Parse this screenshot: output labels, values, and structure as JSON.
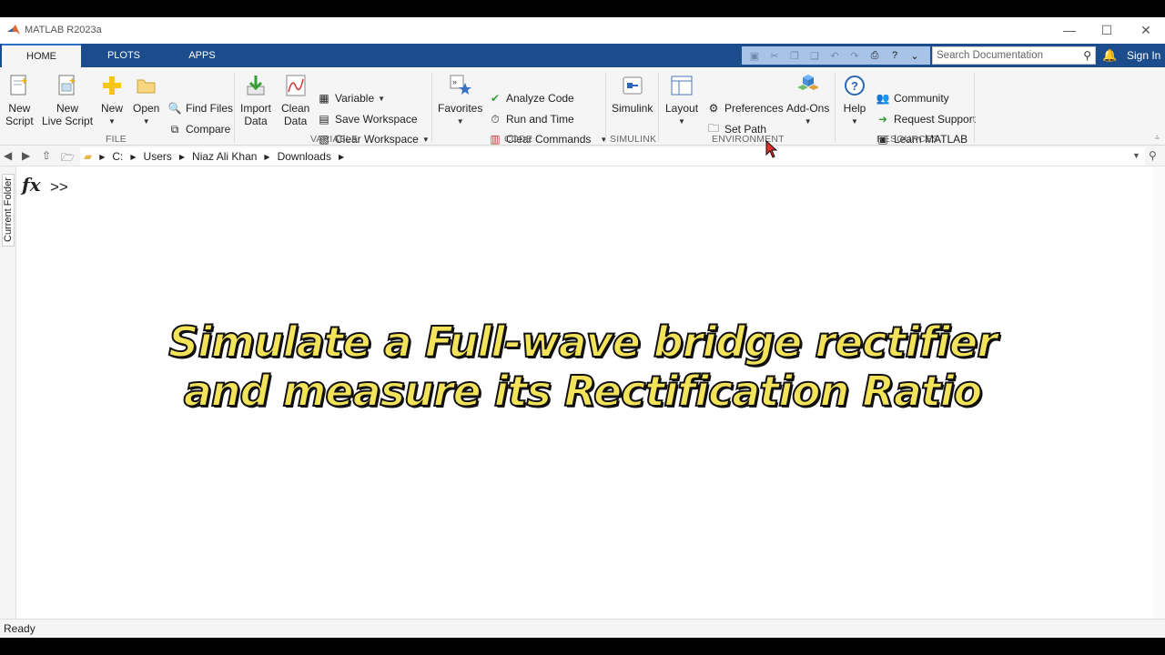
{
  "window": {
    "title": "MATLAB R2023a",
    "minimize_glyph": "—",
    "maximize_glyph": "☐",
    "close_glyph": "✕"
  },
  "tabs": [
    {
      "label": "HOME",
      "active": true
    },
    {
      "label": "PLOTS",
      "active": false
    },
    {
      "label": "APPS",
      "active": false
    }
  ],
  "search": {
    "placeholder": "Search Documentation"
  },
  "account": {
    "sign_in": "Sign In"
  },
  "ribbon": {
    "file": {
      "label": "FILE",
      "new_script": [
        "New",
        "Script"
      ],
      "new_live_script": [
        "New",
        "Live Script"
      ],
      "new": "New",
      "open": "Open",
      "find_files": "Find Files",
      "compare": "Compare"
    },
    "variable": {
      "label": "VARIABLE",
      "import_data": [
        "Import",
        "Data"
      ],
      "clean_data": [
        "Clean",
        "Data"
      ],
      "variable": "Variable",
      "save_workspace": "Save Workspace",
      "clear_workspace": "Clear Workspace"
    },
    "code": {
      "label": "CODE",
      "favorites": "Favorites",
      "analyze_code": "Analyze Code",
      "run_and_time": "Run and Time",
      "clear_commands": "Clear Commands"
    },
    "simulink": {
      "label": "SIMULINK",
      "simulink": "Simulink"
    },
    "environment": {
      "label": "ENVIRONMENT",
      "layout": "Layout",
      "preferences": "Preferences",
      "set_path": "Set Path",
      "add_ons": "Add-Ons"
    },
    "resources": {
      "label": "RESOURCES",
      "help": "Help",
      "community": "Community",
      "request_support": "Request Support",
      "learn_matlab": "Learn MATLAB"
    }
  },
  "address": {
    "segments": [
      "C:",
      "Users",
      "Niaz Ali Khan",
      "Downloads"
    ]
  },
  "side_panel": {
    "current_folder": "Current Folder"
  },
  "command_window": {
    "fx": "fx",
    "prompt": ">>"
  },
  "overlay_text": {
    "line1": "Simulate a Full-wave bridge rectifier",
    "line2": "and measure its Rectification Ratio"
  },
  "status_bar": {
    "text": "Ready"
  },
  "colors": {
    "tab_bar": "#1b4d8c",
    "overlay_fill": "#f3e35a",
    "bell": "#ff6a3d"
  }
}
